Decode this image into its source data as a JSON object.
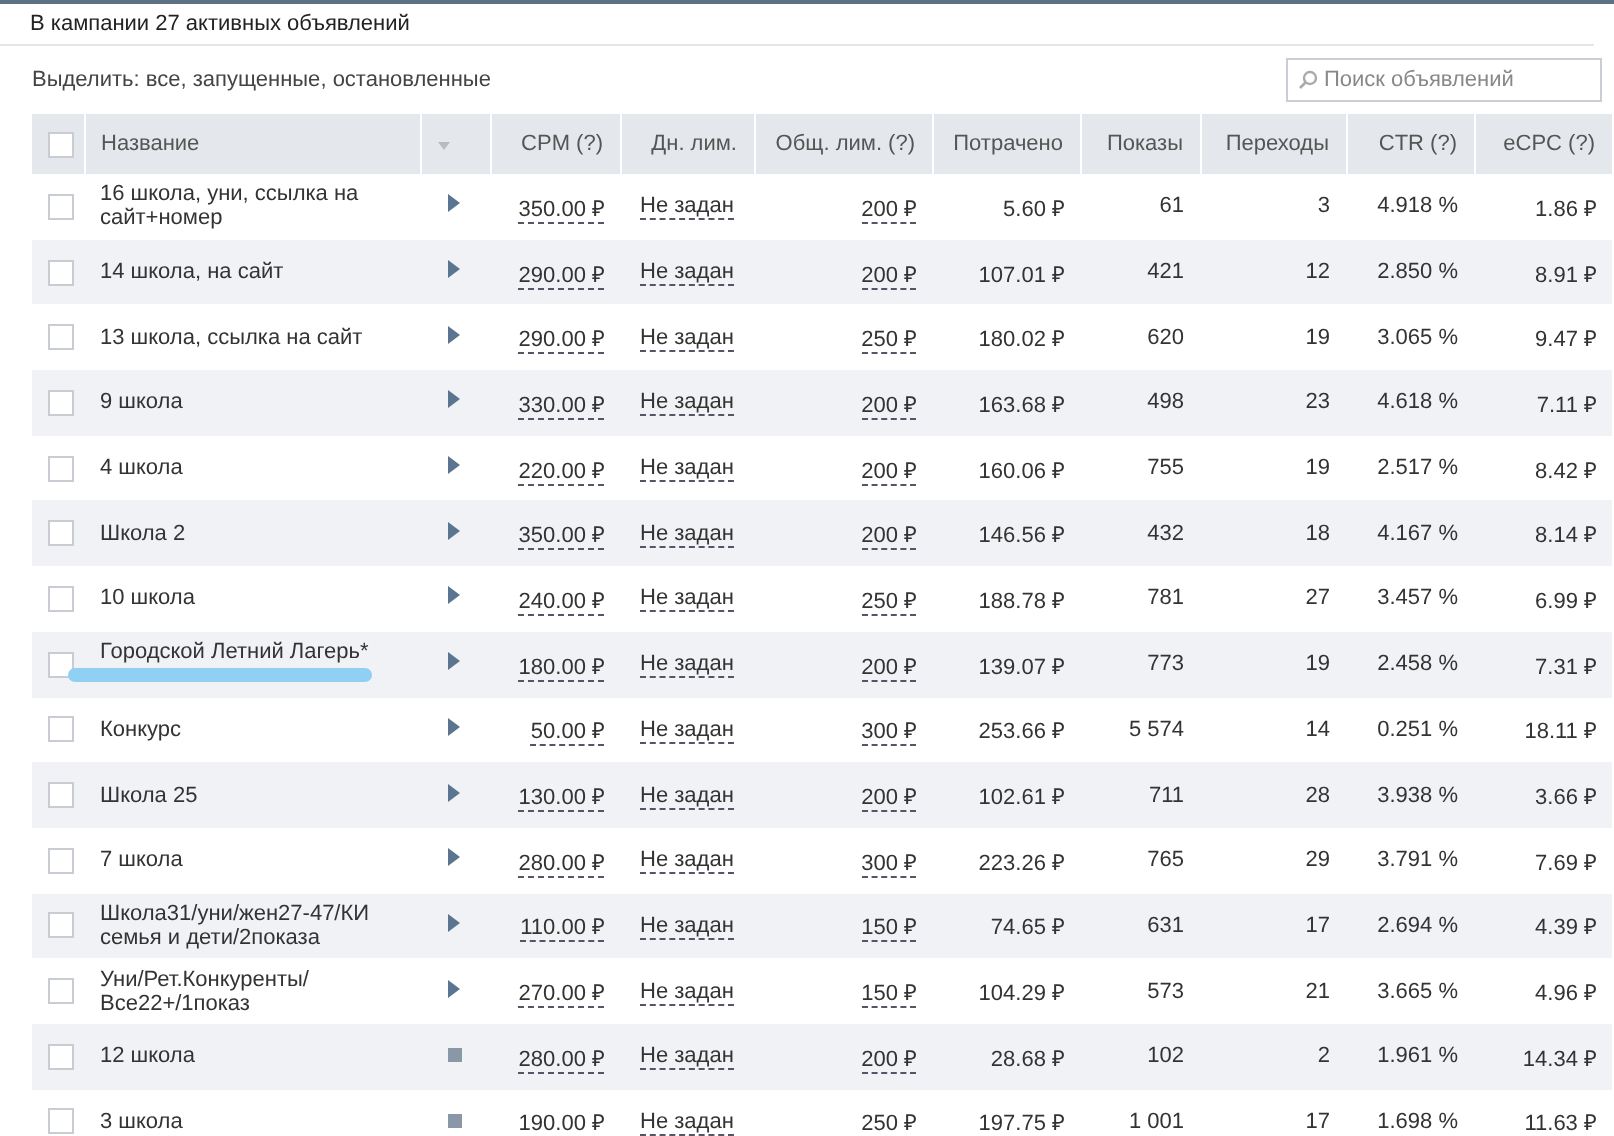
{
  "campaign_summary": "В кампании 27 активных объявлений",
  "select": {
    "label": "Выделить:",
    "links": [
      "все",
      "запущенные",
      "остановленные"
    ],
    "separator": ","
  },
  "select_all": {
    "checked": false
  },
  "search": {
    "placeholder": "Поиск объявлений"
  },
  "table": {
    "columns": [
      "Название",
      "CPM (?)",
      "Дн. лим.",
      "Общ. лим. (?)",
      "Потрачено",
      "Показы",
      "Переходы",
      "CTR (?)",
      "eCPC (?)"
    ],
    "rows": [
      {
        "checked": false,
        "name": "16 школа, уни, ссылка на сайт+номер",
        "running": true,
        "redacted": false,
        "cpm": "350.00 ₽",
        "daily": "Не задан",
        "total": "200 ₽",
        "spent": "5.60 ₽",
        "views": "61",
        "clicks": "3",
        "ctr": "4.918 %",
        "ecpc": "1.86 ₽"
      },
      {
        "checked": false,
        "name": "14 школа, на сайт",
        "running": true,
        "redacted": false,
        "cpm": "290.00 ₽",
        "daily": "Не задан",
        "total": "200 ₽",
        "spent": "107.01 ₽",
        "views": "421",
        "clicks": "12",
        "ctr": "2.850 %",
        "ecpc": "8.91 ₽"
      },
      {
        "checked": false,
        "name": "13 школа, ссылка на сайт",
        "running": true,
        "redacted": false,
        "cpm": "290.00 ₽",
        "daily": "Не задан",
        "total": "250 ₽",
        "spent": "180.02 ₽",
        "views": "620",
        "clicks": "19",
        "ctr": "3.065 %",
        "ecpc": "9.47 ₽"
      },
      {
        "checked": false,
        "name": "9 школа",
        "running": true,
        "redacted": false,
        "cpm": "330.00 ₽",
        "daily": "Не задан",
        "total": "200 ₽",
        "spent": "163.68 ₽",
        "views": "498",
        "clicks": "23",
        "ctr": "4.618 %",
        "ecpc": "7.11 ₽"
      },
      {
        "checked": false,
        "name": "4 школа",
        "running": true,
        "redacted": false,
        "cpm": "220.00 ₽",
        "daily": "Не задан",
        "total": "200 ₽",
        "spent": "160.06 ₽",
        "views": "755",
        "clicks": "19",
        "ctr": "2.517 %",
        "ecpc": "8.42 ₽"
      },
      {
        "checked": false,
        "name": "Школа 2",
        "running": true,
        "redacted": false,
        "cpm": "350.00 ₽",
        "daily": "Не задан",
        "total": "200 ₽",
        "spent": "146.56 ₽",
        "views": "432",
        "clicks": "18",
        "ctr": "4.167 %",
        "ecpc": "8.14 ₽"
      },
      {
        "checked": false,
        "name": "10 школа",
        "running": true,
        "redacted": false,
        "cpm": "240.00 ₽",
        "daily": "Не задан",
        "total": "250 ₽",
        "spent": "188.78 ₽",
        "views": "781",
        "clicks": "27",
        "ctr": "3.457 %",
        "ecpc": "6.99 ₽"
      },
      {
        "checked": false,
        "name": "Городской Летний Лагерь*",
        "running": true,
        "redacted": true,
        "cpm": "180.00 ₽",
        "daily": "Не задан",
        "total": "200 ₽",
        "spent": "139.07 ₽",
        "views": "773",
        "clicks": "19",
        "ctr": "2.458 %",
        "ecpc": "7.31 ₽"
      },
      {
        "checked": false,
        "name": "Конкурс",
        "running": true,
        "redacted": false,
        "cpm": "50.00 ₽",
        "daily": "Не задан",
        "total": "300 ₽",
        "spent": "253.66 ₽",
        "views": "5 574",
        "clicks": "14",
        "ctr": "0.251 %",
        "ecpc": "18.11 ₽"
      },
      {
        "checked": false,
        "name": "Школа 25",
        "running": true,
        "redacted": false,
        "cpm": "130.00 ₽",
        "daily": "Не задан",
        "total": "200 ₽",
        "spent": "102.61 ₽",
        "views": "711",
        "clicks": "28",
        "ctr": "3.938 %",
        "ecpc": "3.66 ₽"
      },
      {
        "checked": false,
        "name": "7 школа",
        "running": true,
        "redacted": false,
        "cpm": "280.00 ₽",
        "daily": "Не задан",
        "total": "300 ₽",
        "spent": "223.26 ₽",
        "views": "765",
        "clicks": "29",
        "ctr": "3.791 %",
        "ecpc": "7.69 ₽"
      },
      {
        "checked": false,
        "name": "Школа31/уни/жен27-47/КИ семья и дети/2показа",
        "running": true,
        "redacted": false,
        "cpm": "110.00 ₽",
        "daily": "Не задан",
        "total": "150 ₽",
        "spent": "74.65 ₽",
        "views": "631",
        "clicks": "17",
        "ctr": "2.694 %",
        "ecpc": "4.39 ₽"
      },
      {
        "checked": false,
        "name": "Уни/Рет.Конкуренты/ Все22+/1показ",
        "running": true,
        "redacted": false,
        "cpm": "270.00 ₽",
        "daily": "Не задан",
        "total": "150 ₽",
        "spent": "104.29 ₽",
        "views": "573",
        "clicks": "21",
        "ctr": "3.665 %",
        "ecpc": "4.96 ₽"
      },
      {
        "checked": false,
        "name": "12 школа",
        "running": false,
        "redacted": false,
        "cpm": "280.00 ₽",
        "daily": "Не задан",
        "total": "200 ₽",
        "spent": "28.68 ₽",
        "views": "102",
        "clicks": "2",
        "ctr": "1.961 %",
        "ecpc": "14.34 ₽"
      },
      {
        "checked": false,
        "name": "3 школа",
        "running": false,
        "redacted": false,
        "cpm": "190.00 ₽",
        "daily": "Не задан",
        "total": "250 ₽",
        "spent": "197.75 ₽",
        "views": "1 001",
        "clicks": "17",
        "ctr": "1.698 %",
        "ecpc": "11.63 ₽"
      }
    ]
  }
}
